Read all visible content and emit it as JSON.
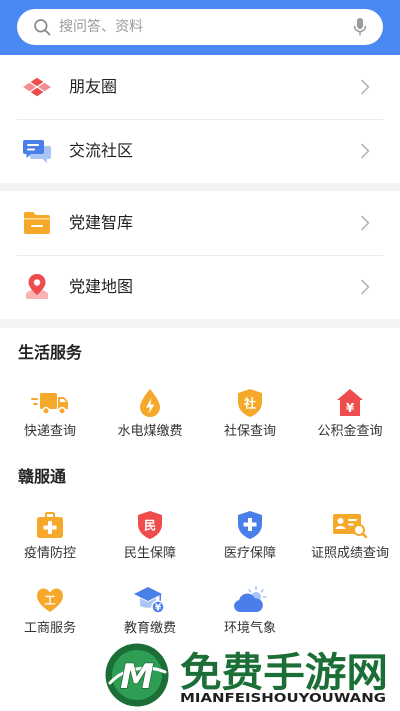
{
  "search": {
    "placeholder": "搜问答、资料",
    "icon": "search-icon",
    "voice_icon": "microphone-icon"
  },
  "menu_groups": [
    {
      "items": [
        {
          "label": "朋友圈",
          "icon": "moments-icon"
        },
        {
          "label": "交流社区",
          "icon": "chat-community-icon"
        }
      ]
    },
    {
      "items": [
        {
          "label": "党建智库",
          "icon": "folder-icon"
        },
        {
          "label": "党建地图",
          "icon": "map-pin-icon"
        }
      ]
    }
  ],
  "sections": [
    {
      "title": "生活服务",
      "items": [
        {
          "label": "快递查询",
          "icon": "delivery-truck-icon"
        },
        {
          "label": "水电煤缴费",
          "icon": "utility-bolt-icon"
        },
        {
          "label": "社保查询",
          "icon": "social-security-shield-icon",
          "glyph": "社"
        },
        {
          "label": "公积金查询",
          "icon": "housing-fund-house-icon",
          "glyph": "¥"
        }
      ]
    },
    {
      "title": "赣服通",
      "items": [
        {
          "label": "疫情防控",
          "icon": "medical-kit-icon"
        },
        {
          "label": "民生保障",
          "icon": "livelihood-shield-icon",
          "glyph": "民"
        },
        {
          "label": "医疗保障",
          "icon": "medical-cross-shield-icon"
        },
        {
          "label": "证照成绩查询",
          "icon": "id-card-search-icon"
        },
        {
          "label": "工商服务",
          "icon": "business-heart-icon",
          "glyph": "工"
        },
        {
          "label": "教育缴费",
          "icon": "graduation-cap-fee-icon",
          "glyph": "¥"
        },
        {
          "label": "环境气象",
          "icon": "cloud-sun-icon"
        }
      ]
    }
  ],
  "watermark": {
    "logo_letter": "M",
    "title": "免费手游网",
    "subtitle": "MIANFEISHOUYOUWANG"
  },
  "colors": {
    "header_blue": "#4a88f2",
    "icon_yellow": "#f6a82a",
    "icon_red": "#ef4d4d",
    "icon_pink": "#f58c8e",
    "icon_blue": "#4a7ee8",
    "icon_light_blue": "#a9c5f6",
    "watermark_green": "#1b6e35"
  }
}
